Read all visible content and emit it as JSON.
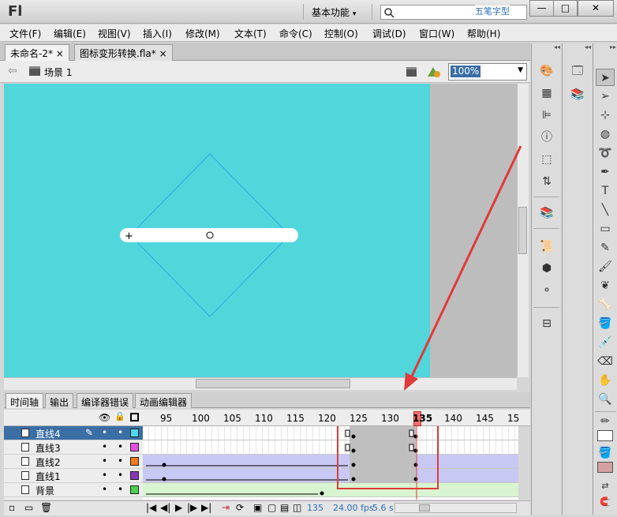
{
  "app": {
    "logo": "Fl",
    "workspace": "基本功能",
    "workspace_arrow": "▾",
    "watermark": "五笔字型",
    "window_buttons": [
      "—",
      "□",
      "✕"
    ]
  },
  "menu": [
    "文件(F)",
    "编辑(E)",
    "视图(V)",
    "插入(I)",
    "修改(M)",
    "文本(T)",
    "命令(C)",
    "控制(O)",
    "调试(D)",
    "窗口(W)",
    "帮助(H)"
  ],
  "doc_tabs": [
    {
      "label": "未命名-2*",
      "close": "×"
    },
    {
      "label": "图标变形转换.fla*",
      "close": "×"
    }
  ],
  "scene": {
    "label": "场景 1",
    "zoom": "100%"
  },
  "timeline_tabs": [
    "时间轴",
    "输出",
    "编译器错误",
    "动画编辑器"
  ],
  "ruler": {
    "start": 95,
    "step": 5,
    "ticks": [
      95,
      100,
      105,
      110,
      115,
      120,
      125,
      130,
      135,
      140,
      145,
      15
    ],
    "current": 135
  },
  "layers": [
    {
      "name": "直线4",
      "selected": true,
      "color": "#4fd8ee"
    },
    {
      "name": "直线3",
      "selected": false,
      "color": "#e150e1"
    },
    {
      "name": "直线2",
      "selected": false,
      "color": "#f07a1c"
    },
    {
      "name": "直线1",
      "selected": false,
      "color": "#8a36b8"
    },
    {
      "name": "背景",
      "selected": false,
      "color": "#4ed14e"
    }
  ],
  "status": {
    "frame": "135",
    "fps": "24.00 fps",
    "time": "5.6 s"
  },
  "colors": {
    "stage": "#51d6dc",
    "accent": "#3a6ea5",
    "highlight_box": "#e03a3a",
    "playhead": "#e03a3a"
  }
}
